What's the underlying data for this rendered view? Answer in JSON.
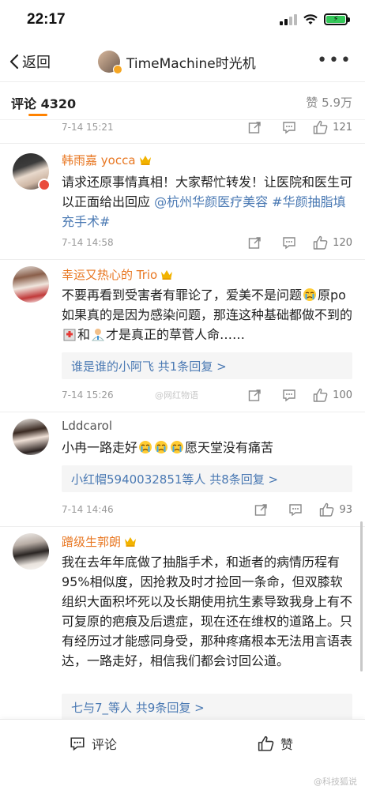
{
  "status": {
    "time": "22:17"
  },
  "nav": {
    "back_label": "返回",
    "title": "TimeMachine时光机",
    "more": "•••"
  },
  "tabs": {
    "comments_label": "评论",
    "comments_count": "4320",
    "likes_label": "赞 5.9万"
  },
  "comments": [
    {
      "time": "7-14 15:21",
      "likes": "121"
    },
    {
      "username": "韩雨嘉 yocca",
      "text_before": "请求还原事情真相！大家帮忙转发！让医院和医生可以正面给出回应 ",
      "link_text": "@杭州华颜医疗美容 #华颜抽脂填充手术#",
      "time": "7-14 14:58",
      "likes": "120"
    },
    {
      "username": "幸运又热心的 Trio",
      "text_a": "不要再看到受害者有罪论了，爱美不是问题",
      "text_b": "原po如果真的是因为感染问题，那连这种基础都做不到的",
      "text_c": "和",
      "text_d": "才是真正的草菅人命……",
      "reply": "谁是谁的小阿飞  共1条回复 >",
      "time": "7-14 15:26",
      "likes": "100"
    },
    {
      "username": "Lddcarol",
      "text_a": "小冉一路走好",
      "text_b": "愿天堂没有痛苦",
      "reply": "小红帽5940032851等人  共8条回复 >",
      "time": "7-14 14:46",
      "likes": "93"
    },
    {
      "username": "蹭级生郭朗",
      "text": "我在去年年底做了抽脂手术，和逝者的病情历程有95%相似度，因抢救及时才捡回一条命，但双膝软组织大面积坏死以及长期使用抗生素导致我身上有不可复原的疤痕及后遗症，现在还在维权的道路上。只有经历过才能感同身受，那种疼痛根本无法用言语表达，一路走好，相信我们都会讨回公道。",
      "reply": "七与7_等人  共9条回复 >"
    }
  ],
  "watermarks": {
    "mid": "@网红物语",
    "bottom_right": "@科技狐说"
  },
  "bottom_bar": {
    "comment_label": "评论",
    "like_label": "赞"
  },
  "colors": {
    "accent": "#ff8200",
    "username": "#e87722",
    "link": "#4a79b3"
  }
}
